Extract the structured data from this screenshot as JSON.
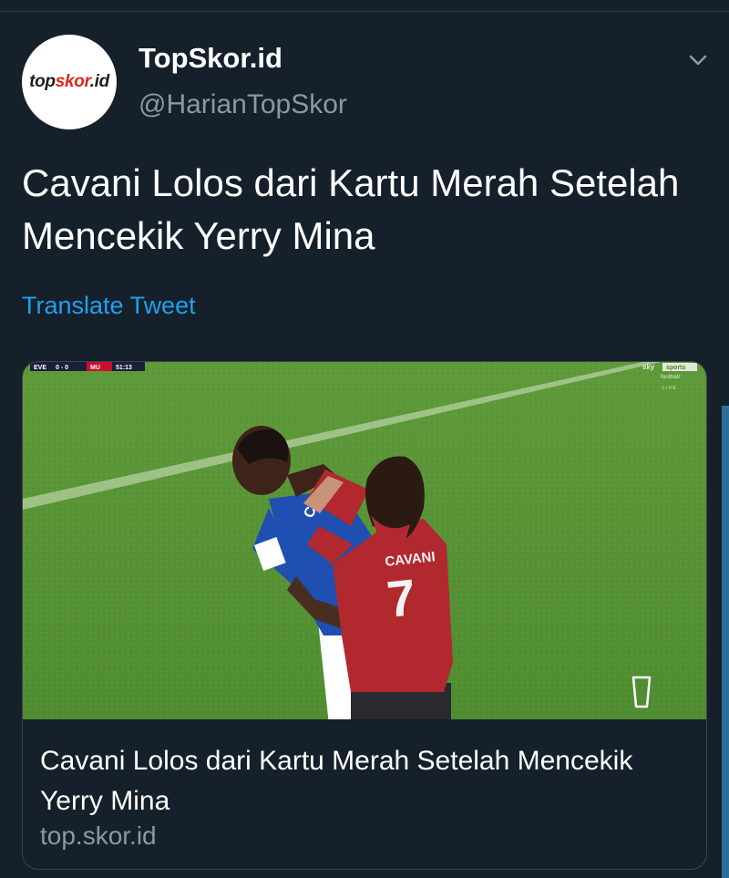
{
  "account": {
    "name": "TopSkor.id",
    "handle": "@HarianTopSkor",
    "avatar_logo": {
      "part1": "top",
      "part2": "skor",
      "part3": ".id"
    },
    "avatar_colors": {
      "text": "#1d1d1d",
      "accent": "#e2231a",
      "background": "#ffffff"
    }
  },
  "tweet": {
    "text": "Cavani Lolos dari Kartu Merah Setelah Mencekik Yerry Mina",
    "translate_label": "Translate Tweet"
  },
  "card": {
    "title": "Cavani Lolos dari Kartu Merah Setelah Mencekik Yerry Mina",
    "domain": "top.skor.id",
    "image": {
      "scoreboard": {
        "home": "EVE",
        "score": "0 - 0",
        "away": "MU",
        "clock": "51:13"
      },
      "broadcaster": {
        "line1": "sky",
        "line2": "sports",
        "line3": "football",
        "line4": "LIVE"
      },
      "shirt_name": "CAVANI",
      "shirt_number": "7",
      "blue_shirt_text": "CAZ"
    }
  },
  "icons": {
    "menu": "chevron-down-icon"
  },
  "colors": {
    "background": "#15202b",
    "link": "#1da1f2",
    "secondary_text": "#8899a6",
    "border": "#38444d"
  }
}
